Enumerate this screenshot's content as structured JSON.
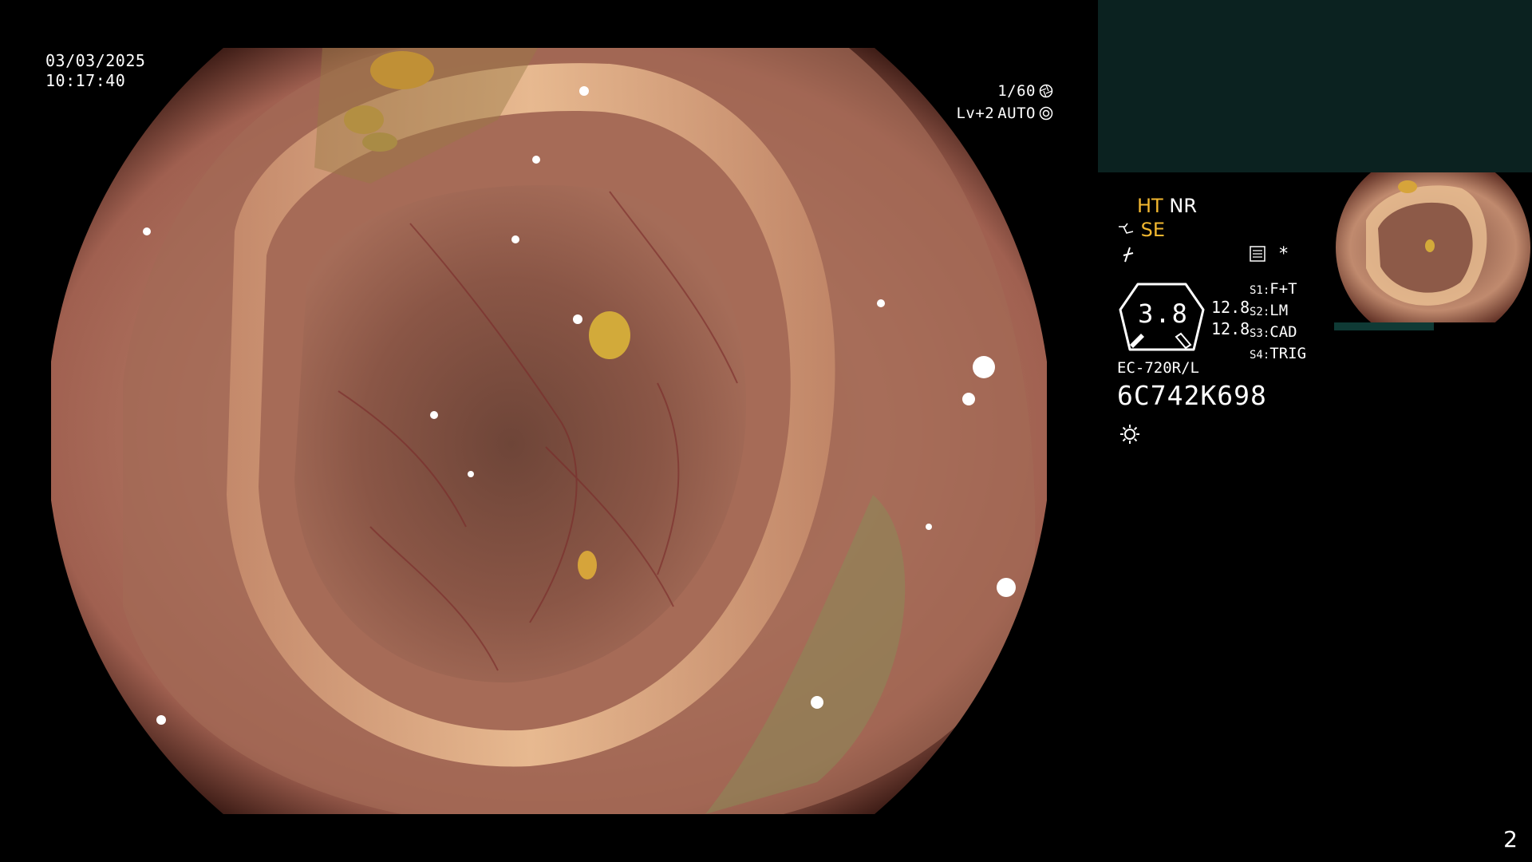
{
  "overlay": {
    "date": "03/03/2025",
    "time": "10:17:40",
    "shutter": "1/60",
    "level": "Lv+2",
    "iris_mode": "AUTO"
  },
  "status": {
    "ht": "HT",
    "nr": "NR",
    "se": "SE",
    "dial_value": "3.8",
    "dual_value_1": "12.8",
    "dual_value_2": "12.8",
    "switches": [
      {
        "key": "S1:",
        "value": "F+T"
      },
      {
        "key": "S2:",
        "value": "LM"
      },
      {
        "key": "S3:",
        "value": "CAD"
      },
      {
        "key": "S4:",
        "value": "TRIG"
      }
    ],
    "asterisk": "*"
  },
  "scope": {
    "model": "EC-720R/L",
    "serial": "6C742K698"
  },
  "page_number": "2",
  "icons": [
    "shutter-icon",
    "iris-icon",
    "structure-icon",
    "function-icon",
    "memory-icon",
    "light-icon"
  ],
  "colors": {
    "accent": "#f2b830",
    "panel": "#0b2220"
  }
}
